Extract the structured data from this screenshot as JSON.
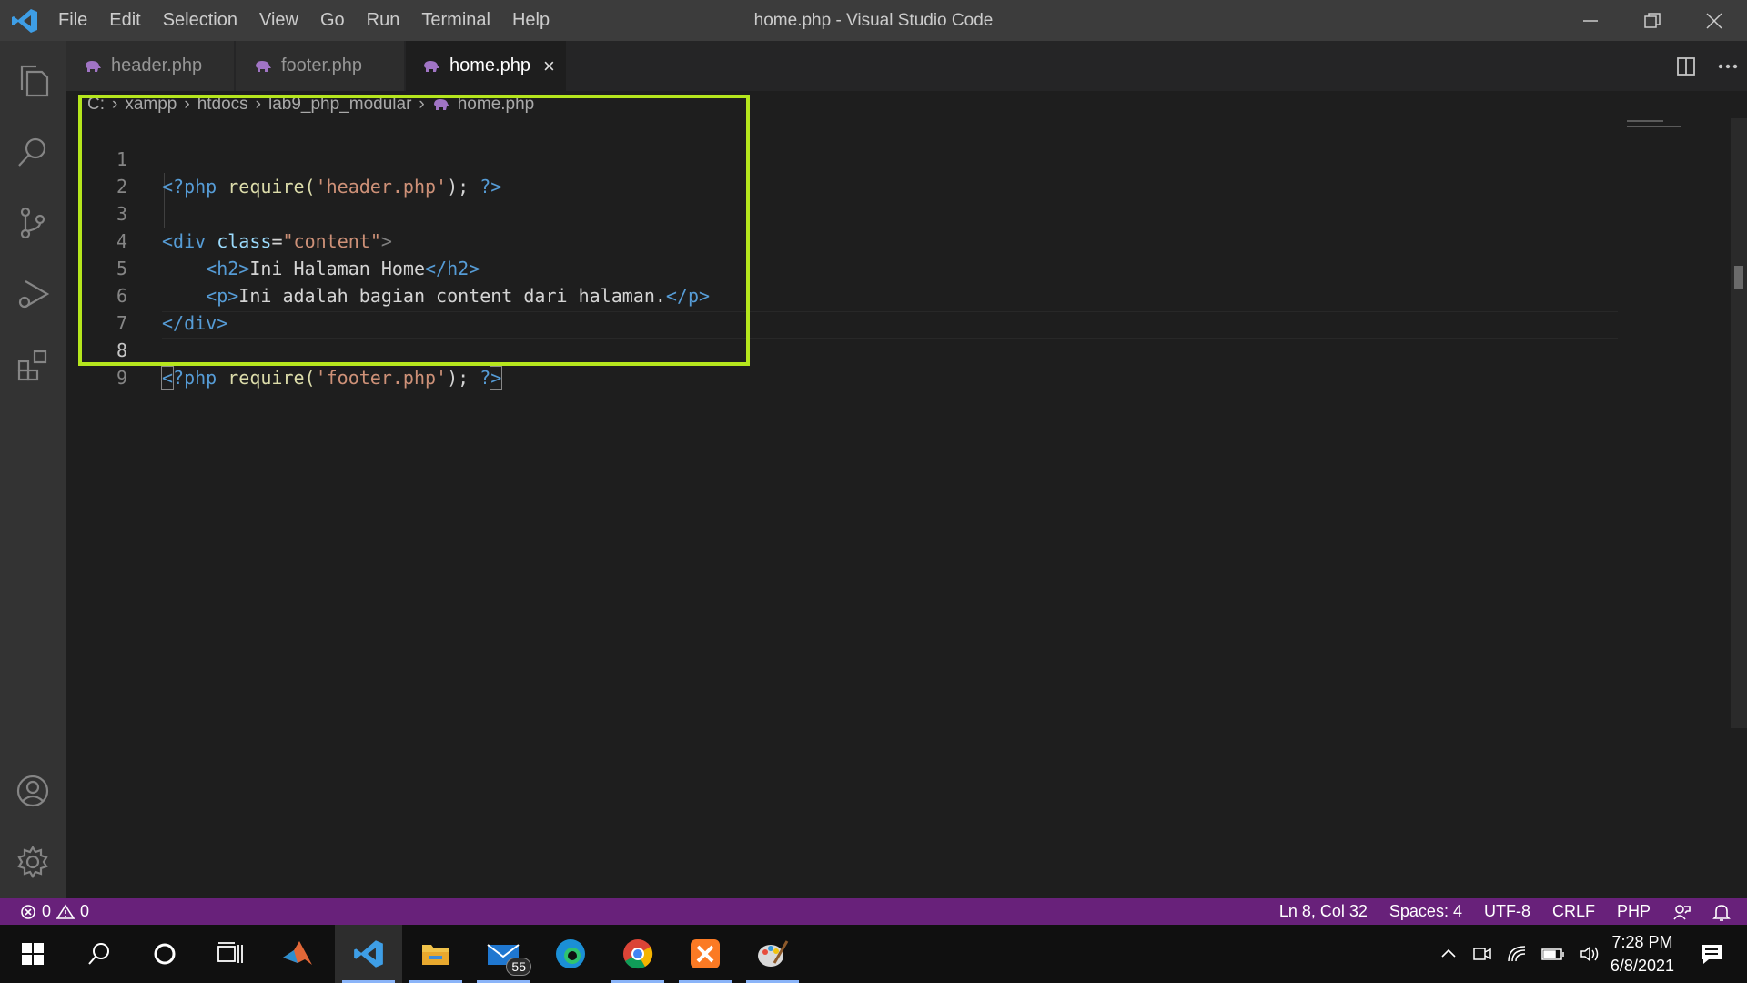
{
  "window": {
    "title": "home.php - Visual Studio Code",
    "menu": [
      "File",
      "Edit",
      "Selection",
      "View",
      "Go",
      "Run",
      "Terminal",
      "Help"
    ]
  },
  "tabs": [
    {
      "label": "header.php",
      "active": false
    },
    {
      "label": "footer.php",
      "active": false
    },
    {
      "label": "home.php",
      "active": true
    }
  ],
  "breadcrumb": [
    "C:",
    "xampp",
    "htdocs",
    "lab9_php_modular",
    "home.php"
  ],
  "editor": {
    "line_numbers": [
      "1",
      "2",
      "3",
      "4",
      "5",
      "6",
      "7",
      "8",
      "9"
    ],
    "current_line": 8,
    "line1": {
      "open": "<?php",
      "fn": "require(",
      "str": "'header.php'",
      "end": ");",
      "close": "?>"
    },
    "line3": {
      "open": "<div",
      "attr": "class",
      "eq": "=",
      "str": "\"content\"",
      "gt": ">"
    },
    "line4": {
      "open": "<h2>",
      "text": "Ini Halaman Home",
      "close": "</h2>"
    },
    "line5": {
      "open": "<p>",
      "text": "Ini adalah bagian content dari halaman.",
      "close": "</p>"
    },
    "line6": {
      "close": "</div>"
    },
    "line8": {
      "lt": "<",
      "open": "?php",
      "fn": "require(",
      "str": "'footer.php'",
      "end": ");",
      "q": "?",
      "gt": ">"
    }
  },
  "statusbar": {
    "errors": "0",
    "warnings": "0",
    "position": "Ln 8, Col 32",
    "spaces": "Spaces: 4",
    "encoding": "UTF-8",
    "eol": "CRLF",
    "language": "PHP",
    "color": "#68217a"
  },
  "taskbar": {
    "mail_badge": "55",
    "time": "7:28 PM",
    "date": "6/8/2021"
  },
  "colors": {
    "highlight_box": "#b5e61d",
    "php_icon": "#a074c4"
  }
}
